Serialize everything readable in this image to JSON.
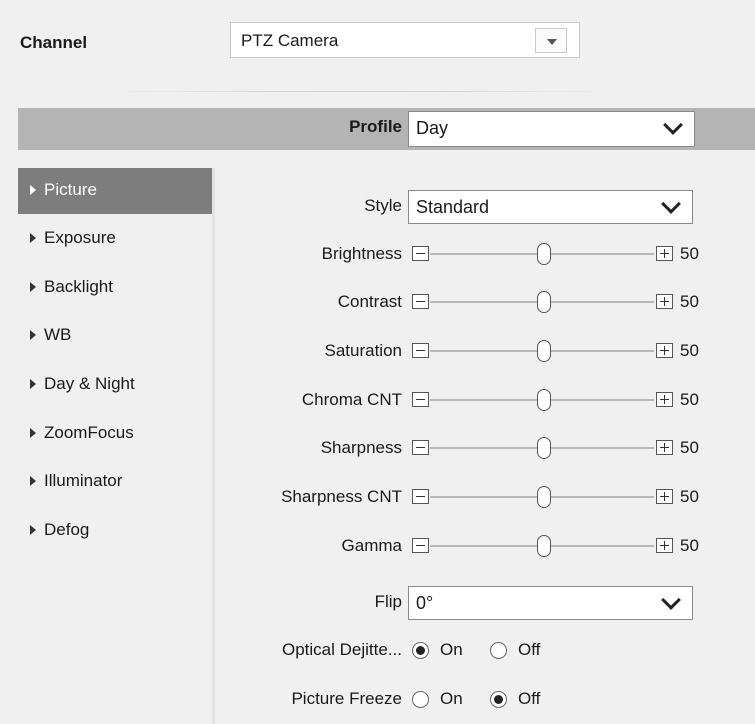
{
  "channel": {
    "label": "Channel",
    "value": "PTZ Camera"
  },
  "profile": {
    "label": "Profile",
    "value": "Day"
  },
  "sidebar": {
    "items": [
      {
        "label": "Picture",
        "active": true
      },
      {
        "label": "Exposure"
      },
      {
        "label": "Backlight"
      },
      {
        "label": "WB"
      },
      {
        "label": "Day & Night"
      },
      {
        "label": "ZoomFocus"
      },
      {
        "label": "Illuminator"
      },
      {
        "label": "Defog"
      }
    ]
  },
  "picture": {
    "style": {
      "label": "Style",
      "value": "Standard"
    },
    "sliders": [
      {
        "label": "Brightness",
        "value": "50"
      },
      {
        "label": "Contrast",
        "value": "50"
      },
      {
        "label": "Saturation",
        "value": "50"
      },
      {
        "label": "Chroma CNT",
        "value": "50"
      },
      {
        "label": "Sharpness",
        "value": "50"
      },
      {
        "label": "Sharpness CNT",
        "value": "50"
      },
      {
        "label": "Gamma",
        "value": "50"
      }
    ],
    "flip": {
      "label": "Flip",
      "value": "0°"
    },
    "optical_dejitter": {
      "label": "Optical Dejitte...",
      "on_label": "On",
      "off_label": "Off",
      "selected": "On"
    },
    "picture_freeze": {
      "label": "Picture Freeze",
      "on_label": "On",
      "off_label": "Off",
      "selected": "Off"
    }
  }
}
